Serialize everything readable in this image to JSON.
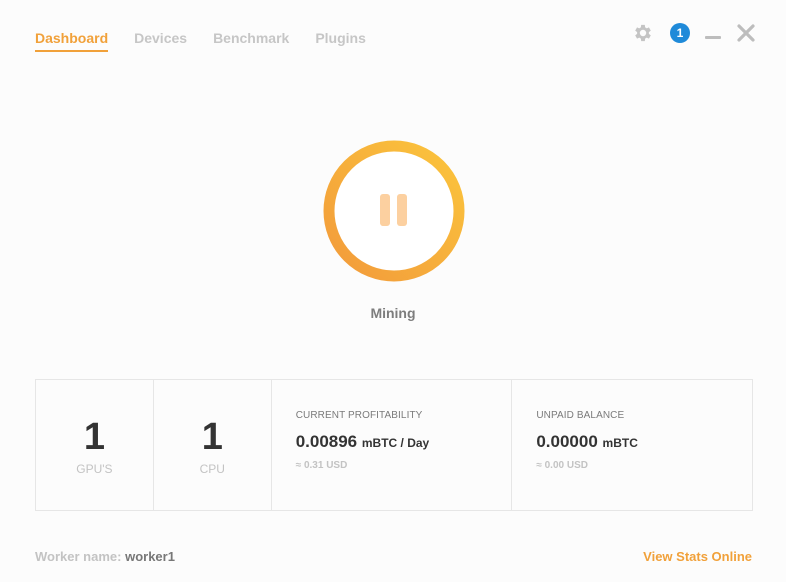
{
  "tabs": [
    {
      "label": "Dashboard",
      "active": true
    },
    {
      "label": "Devices",
      "active": false
    },
    {
      "label": "Benchmark",
      "active": false
    },
    {
      "label": "Plugins",
      "active": false
    }
  ],
  "header": {
    "notification_count": "1",
    "icons": [
      "gear-icon",
      "notification-badge",
      "minimize-icon",
      "close-icon"
    ]
  },
  "mining": {
    "status_label": "Mining",
    "button_icon": "pause-icon",
    "ring_colors": [
      "#f29a3b",
      "#fbc53c"
    ]
  },
  "stats": {
    "gpus": {
      "value": "1",
      "label": "GPU'S"
    },
    "cpu": {
      "value": "1",
      "label": "CPU"
    },
    "profitability": {
      "title": "CURRENT PROFITABILITY",
      "value": "0.00896",
      "unit": "mBTC / Day",
      "fiat": "≈ 0.31 USD"
    },
    "balance": {
      "title": "UNPAID BALANCE",
      "value": "0.00000",
      "unit": "mBTC",
      "fiat": "≈ 0.00 USD"
    }
  },
  "footer": {
    "worker_label": "Worker name:",
    "worker_value": "worker1",
    "view_stats": "View Stats Online"
  },
  "colors": {
    "accent": "#f1a13a",
    "badge": "#1f8ad9"
  }
}
